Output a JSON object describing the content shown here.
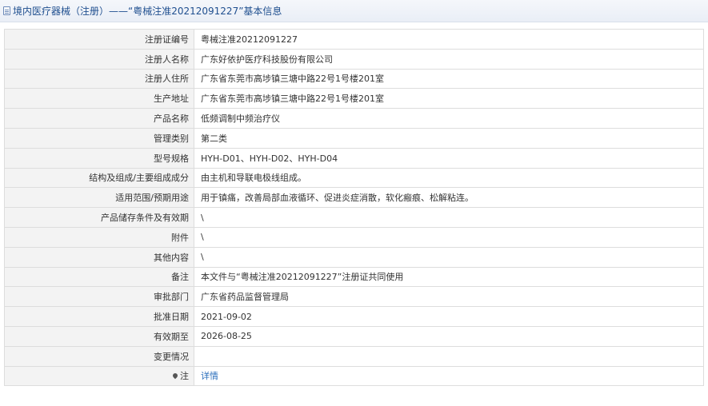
{
  "header": {
    "icon": "document-icon",
    "title": "境内医疗器械（注册）——“粤械注准20212091227”基本信息"
  },
  "rows": [
    {
      "label": "注册证编号",
      "value": "粤械注准20212091227"
    },
    {
      "label": "注册人名称",
      "value": "广东好依护医疗科技股份有限公司"
    },
    {
      "label": "注册人住所",
      "value": "广东省东莞市高埗镇三塘中路22号1号楼201室"
    },
    {
      "label": "生产地址",
      "value": "广东省东莞市高埗镇三塘中路22号1号楼201室"
    },
    {
      "label": "产品名称",
      "value": "低频调制中频治疗仪"
    },
    {
      "label": "管理类别",
      "value": "第二类"
    },
    {
      "label": "型号规格",
      "value": "HYH-D01、HYH-D02、HYH-D04"
    },
    {
      "label": "结构及组成/主要组成成分",
      "value": "由主机和导联电极线组成。"
    },
    {
      "label": "适用范围/预期用途",
      "value": "用于镇痛，改善局部血液循环、促进炎症消散，软化瘢痕、松解粘连。"
    },
    {
      "label": "产品储存条件及有效期",
      "value": "\\"
    },
    {
      "label": "附件",
      "value": "\\"
    },
    {
      "label": "其他内容",
      "value": "\\"
    },
    {
      "label": "备注",
      "value": "本文件与“粤械注准20212091227”注册证共同使用"
    },
    {
      "label": "审批部门",
      "value": "广东省药品监督管理局"
    },
    {
      "label": "批准日期",
      "value": "2021-09-02"
    },
    {
      "label": "有效期至",
      "value": "2026-08-25"
    },
    {
      "label": "变更情况",
      "value": ""
    }
  ],
  "note_row": {
    "icon": "pin-icon",
    "label": "注",
    "link_text": "详情"
  }
}
